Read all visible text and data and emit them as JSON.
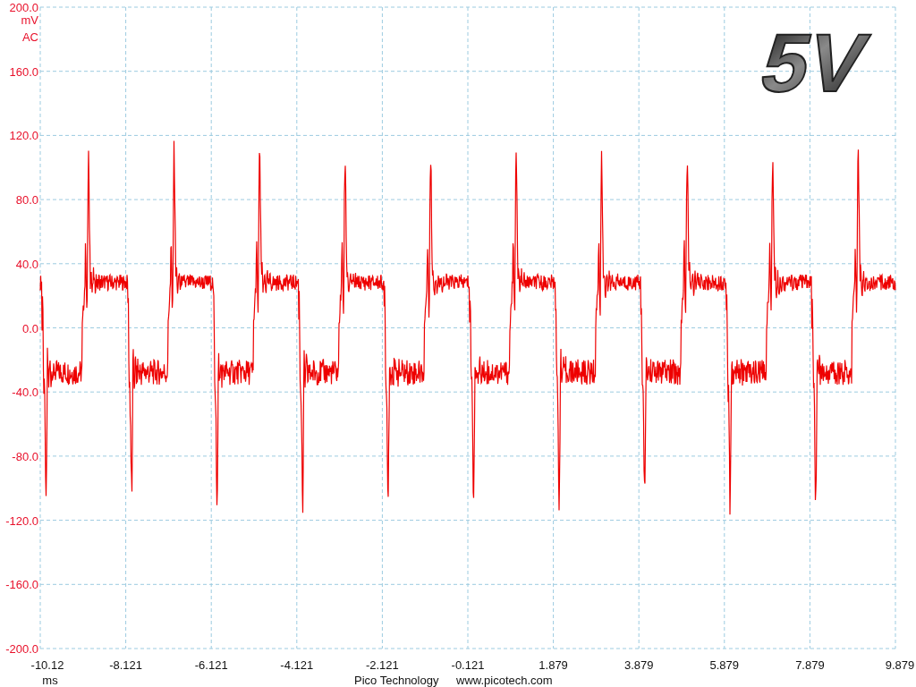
{
  "plot": {
    "y_ticks": [
      "200.0",
      "160.0",
      "120.0",
      "80.0",
      "40.0",
      "0.0",
      "-40.0",
      "-80.0",
      "-120.0",
      "-160.0",
      "-200.0"
    ],
    "y_unit": "mV",
    "coupling": "AC",
    "x_ticks": [
      "-10.12",
      "-8.121",
      "-6.121",
      "-4.121",
      "-2.121",
      "-0.121",
      "1.879",
      "3.879",
      "5.879",
      "7.879",
      "9.879"
    ],
    "x_unit": "ms",
    "overlay_label": "5V"
  },
  "footer": [
    "Pico Technology",
    "www.picotech.com"
  ]
}
